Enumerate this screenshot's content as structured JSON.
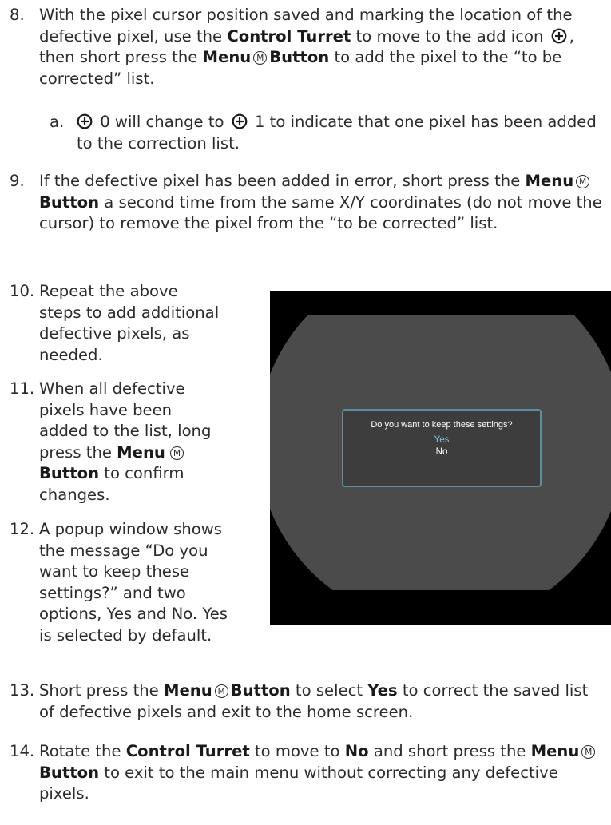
{
  "steps": {
    "s8": {
      "num": "8.",
      "t1": "With the pixel cursor position saved and marking the location of the defective pixel, use the ",
      "b1": "Control Turret",
      "t2": " to move to the add icon ",
      "t3": ", then short press the ",
      "b2": "Menu",
      "b3": "Button",
      "t4": " to add the pixel to the “to be corrected” list."
    },
    "s8a": {
      "num": "a.",
      "t1": " 0 will change to ",
      "t2": " 1 to indicate that one pixel has been added to the correction list."
    },
    "s9": {
      "num": "9.",
      "t1": "If the defective pixel has been added in error, short press the ",
      "b1": "Menu",
      "b2": "Button",
      "t2": " a second time from the same X/Y coordinates (do not move the cursor) to remove the pixel from the “to be corrected” list."
    },
    "s10": {
      "num": "10.",
      "t1": "Repeat the above steps to add additional defective pixels, as needed."
    },
    "s11": {
      "num": "11.",
      "t1": "When all defective pixels have been added to the list, long press the ",
      "b1": "Menu",
      "b2": "Button",
      "t2": " to confirm changes."
    },
    "s12": {
      "num": "12.",
      "t1": "A popup window shows the message “Do you want to keep these settings?” and two options, Yes and No. Yes is selected by default."
    },
    "s13": {
      "num": "13.",
      "t1": "Short press the ",
      "b1": "Menu",
      "b2": "Button",
      "t2": " to select ",
      "b3": "Yes",
      "t3": " to correct the saved list of defective pixels and exit to the home screen."
    },
    "s14": {
      "num": "14.",
      "t1": "Rotate the ",
      "b1": "Control Turret",
      "t2": " to move to ",
      "b2": "No",
      "t3": " and short press the ",
      "b3": "Menu",
      "b4": "Button",
      "t4": " to exit to the main menu without correcting any defective pixels."
    }
  },
  "menu_icon_letter": "M",
  "icons": {
    "add": "add-circle-icon",
    "menu": "menu-m-icon"
  },
  "screen": {
    "message": "Do you want to keep these settings?",
    "option_yes": "Yes",
    "option_no": "No",
    "colors": {
      "background": "#000000",
      "lens": "#4b4b4b",
      "popup_border": "#5d8fa0",
      "selected": "#7fc6e0"
    }
  }
}
